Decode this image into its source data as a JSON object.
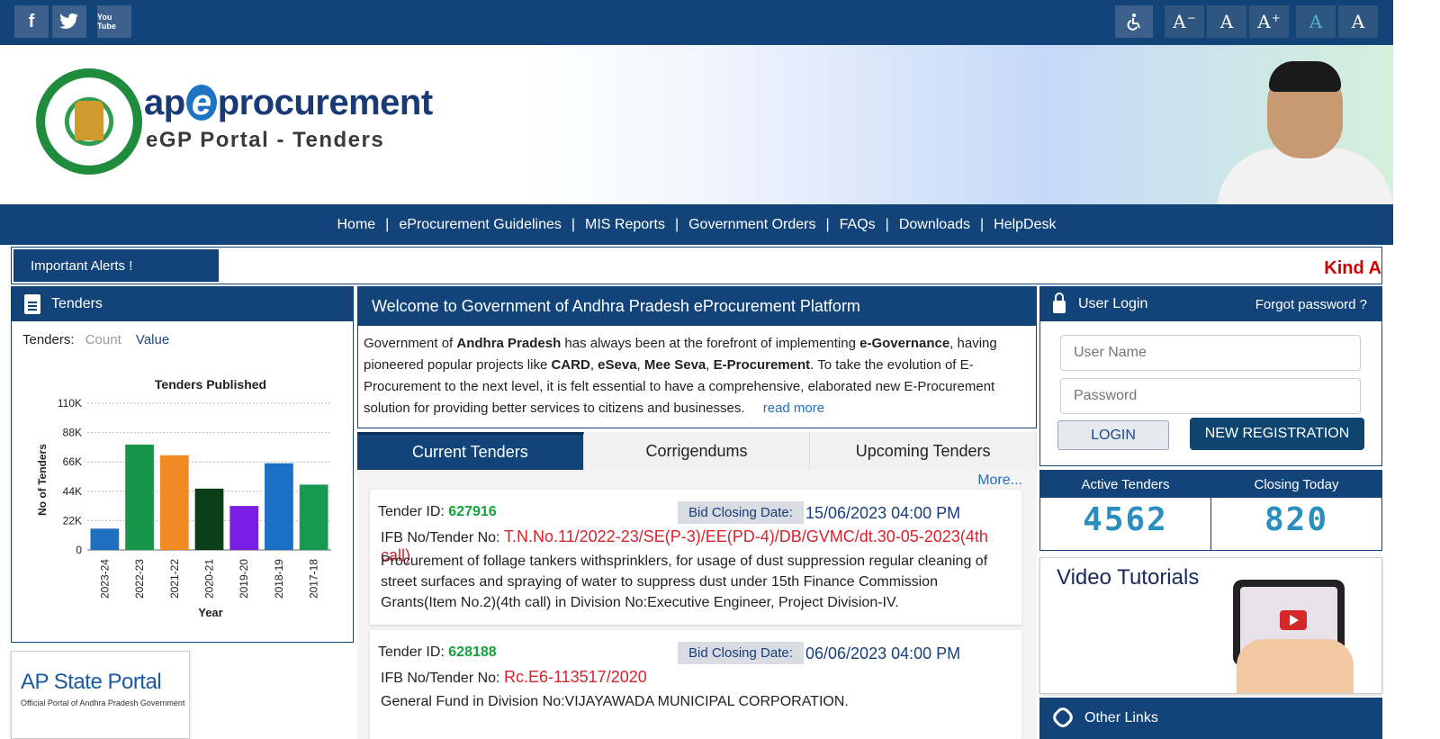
{
  "social": {
    "facebook": "f",
    "twitter": "t",
    "youtube": "You Tube"
  },
  "accessibility": {
    "labels": [
      "A",
      "A",
      "A",
      "A",
      "A"
    ],
    "decrease_sup": "−",
    "increase_sup": "+"
  },
  "banner": {
    "logo_prefix": "ap",
    "logo_e": "e",
    "logo_suffix": "procurement",
    "subtitle": "eGP Portal - Tenders"
  },
  "nav": {
    "items": [
      "Home",
      "eProcurement Guidelines",
      "MIS Reports",
      "Government Orders",
      "FAQs",
      "Downloads",
      "HelpDesk"
    ]
  },
  "alerts": {
    "label": "Important Alerts !",
    "marquee": "Kind A"
  },
  "tenders_panel": {
    "title": "Tenders",
    "toggle_label": "Tenders:",
    "toggle_count": "Count",
    "toggle_value": "Value"
  },
  "chart_data": {
    "type": "bar",
    "title": "Tenders Published",
    "xlabel": "Year",
    "ylabel": "No of Tenders",
    "categories": [
      "2023-24",
      "2022-23",
      "2021-22",
      "2020-21",
      "2019-20",
      "2018-19",
      "2017-18"
    ],
    "values": [
      16000,
      79000,
      71000,
      46000,
      33000,
      65000,
      49000
    ],
    "colors": [
      "#1f6fc0",
      "#17964a",
      "#ef8b22",
      "#0c3f17",
      "#7a1ee6",
      "#1b6fc5",
      "#169a52"
    ],
    "yticks": [
      "0",
      "22K",
      "44K",
      "66K",
      "88K",
      "110K"
    ],
    "ylim": [
      0,
      110000
    ],
    "grid": true
  },
  "ap_portal": {
    "title": "AP State Portal",
    "subtitle": "Official Portal of Andhra Pradesh Government"
  },
  "welcome": {
    "title": "Welcome to Government of Andhra Pradesh eProcurement Platform",
    "p1": "Government of ",
    "b1": "Andhra Pradesh",
    "p2": " has always been at the forefront of implementing ",
    "b2": "e-Governance",
    "p3": ", having pioneered popular projects like ",
    "b3": "CARD",
    "p4": ", ",
    "b4": "eSeva",
    "p5": ", ",
    "b5": "Mee Seva",
    "p6": ", ",
    "b6": "E-Procurement",
    "p7": ". To take the evolution of E-Procurement to the next level, it is felt essential to have a comprehensive, elaborated new E-Procurement solution for providing better services to citizens and businesses.",
    "read_more": "read more"
  },
  "tabs": [
    "Current Tenders",
    "Corrigendums",
    "Upcoming Tenders"
  ],
  "tender_list": {
    "more": "More...",
    "id_label": "Tender ID:",
    "closing_label": "Bid Closing Date:",
    "ifb_label": "IFB No/Tender No:",
    "items": [
      {
        "id": "627916",
        "closing": "15/06/2023 04:00 PM",
        "ifb": "T.N.No.11/2022-23/SE(P-3)/EE(PD-4)/DB/GVMC/dt.30-05-2023(4th call)",
        "desc": "Procurement of follage tankers withsprinklers, for usage of dust suppression regular cleaning of street surfaces and spraying of water to suppress dust under 15th Finance Commission Grants(Item No.2)(4th call) in Division No:Executive Engineer, Project Division-IV."
      },
      {
        "id": "628188",
        "closing": "06/06/2023 04:00 PM",
        "ifb": "Rc.E6-113517/2020",
        "desc": "General Fund in Division No:VIJAYAWADA MUNICIPAL CORPORATION."
      }
    ]
  },
  "login": {
    "title": "User Login",
    "forgot": "Forgot password ?",
    "username_placeholder": "User Name",
    "password_placeholder": "Password",
    "login_btn": "LOGIN",
    "register_btn": "NEW REGISTRATION"
  },
  "stats": {
    "active_label": "Active Tenders",
    "active_value": "4562",
    "closing_label": "Closing Today",
    "closing_value": "820"
  },
  "video": {
    "title": "Video Tutorials"
  },
  "other_links": {
    "title": "Other Links"
  }
}
